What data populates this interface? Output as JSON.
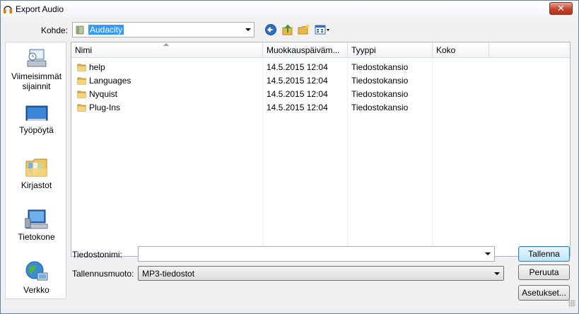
{
  "window": {
    "title": "Export Audio",
    "close_glyph": "✕"
  },
  "location": {
    "label": "Kohde:",
    "value": "Audacity"
  },
  "toolbar": {
    "back_icon": "back-arrow-icon",
    "up_icon": "up-folder-icon",
    "new_folder_icon": "new-folder-icon",
    "view_icon": "view-menu-icon"
  },
  "places": [
    {
      "label_line1": "Viimeisimmät",
      "label_line2": "sijainnit",
      "icon": "recent-places-icon"
    },
    {
      "label_line1": "Työpöytä",
      "label_line2": "",
      "icon": "desktop-icon"
    },
    {
      "label_line1": "Kirjastot",
      "label_line2": "",
      "icon": "libraries-icon"
    },
    {
      "label_line1": "Tietokone",
      "label_line2": "",
      "icon": "computer-icon"
    },
    {
      "label_line1": "Verkko",
      "label_line2": "",
      "icon": "network-icon"
    }
  ],
  "columns": [
    "Nimi",
    "Muokkauspäiväm...",
    "Tyyppi",
    "Koko"
  ],
  "files": [
    {
      "name": "help",
      "modified": "14.5.2015 12:04",
      "type": "Tiedostokansio",
      "size": ""
    },
    {
      "name": "Languages",
      "modified": "14.5.2015 12:04",
      "type": "Tiedostokansio",
      "size": ""
    },
    {
      "name": "Nyquist",
      "modified": "14.5.2015 12:04",
      "type": "Tiedostokansio",
      "size": ""
    },
    {
      "name": "Plug-Ins",
      "modified": "14.5.2015 12:04",
      "type": "Tiedostokansio",
      "size": ""
    }
  ],
  "filename": {
    "label": "Tiedostonimi:",
    "value": ""
  },
  "filetype": {
    "label": "Tallennusmuoto:",
    "value": "MP3-tiedostot"
  },
  "buttons": {
    "save": "Tallenna",
    "cancel": "Peruuta",
    "options": "Asetukset..."
  },
  "colors": {
    "folder": "#e8b84a",
    "selection": "#3399ff",
    "close": "#c6422b"
  }
}
